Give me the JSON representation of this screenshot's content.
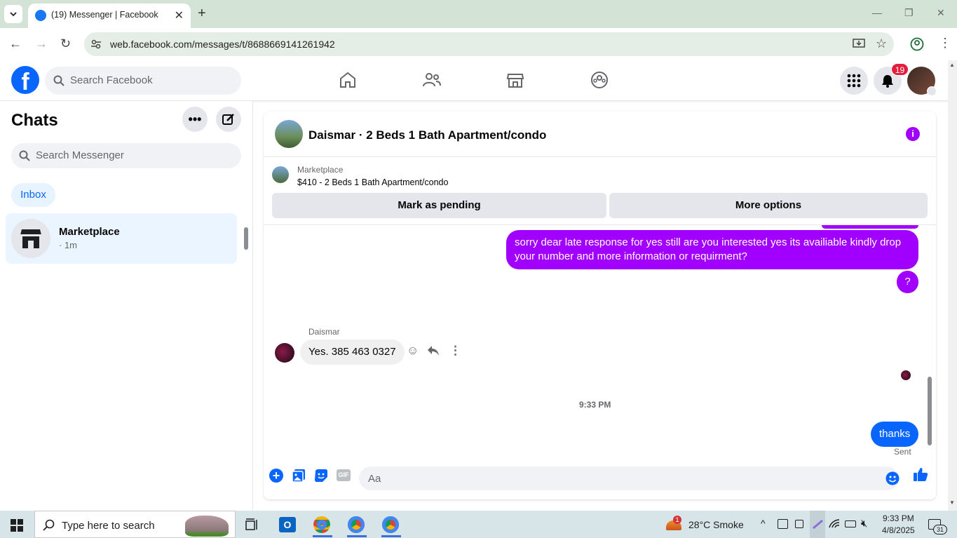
{
  "browser": {
    "tab_title": "(19) Messenger | Facebook",
    "url": "web.facebook.com/messages/t/8688669141261942"
  },
  "fb_header": {
    "search_placeholder": "Search Facebook",
    "notification_count": "19"
  },
  "chats": {
    "title": "Chats",
    "search_placeholder": "Search Messenger",
    "filter_tab": "Inbox",
    "items": [
      {
        "name": "Marketplace",
        "time": "· 1m"
      }
    ]
  },
  "conversation": {
    "title": "Daismar · 2 Beds 1 Bath Apartment/condo",
    "marketplace_label": "Marketplace",
    "listing": "$410 - 2 Beds 1 Bath Apartment/condo",
    "mark_pending_label": "Mark as pending",
    "more_options_label": "More options",
    "messages": [
      {
        "text": "sorry dear late response for yes still are you interested yes its availiable  kindly  drop your number and more information or requirment?"
      },
      {
        "text": "?"
      },
      {
        "sender": "Daismar",
        "text": "Yes. 385 463 0327"
      },
      {
        "text": "thanks"
      }
    ],
    "timestamp": "9:33 PM",
    "sent_status": "Sent",
    "composer_placeholder": "Aa"
  },
  "taskbar": {
    "search_placeholder": "Type here to search",
    "weather": "28°C  Smoke",
    "weather_badge": "1",
    "clock_time": "9:33 PM",
    "clock_date": "4/8/2025",
    "notification_count": "31"
  },
  "colors": {
    "fb_blue": "#0866ff",
    "purple_bubble": "#a100ff",
    "badge_red": "#e41e3f"
  }
}
